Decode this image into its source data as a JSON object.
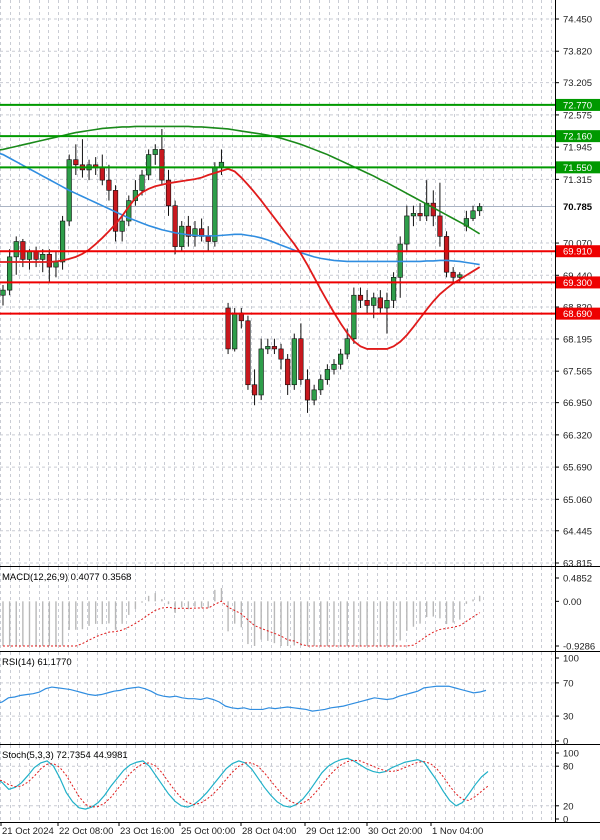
{
  "chart_data": {
    "type": "candlestick",
    "price_axis": {
      "ticks": [
        "74.450",
        "73.820",
        "73.205",
        "72.575",
        "71.945",
        "71.315",
        "70.070",
        "69.440",
        "68.820",
        "68.195",
        "67.565",
        "66.950",
        "66.320",
        "65.690",
        "65.060",
        "64.445",
        "63.815"
      ],
      "range": [
        63.815,
        74.45
      ]
    },
    "time_axis": {
      "labels": [
        "21 Oct 2024",
        "22 Oct 08:00",
        "23 Oct 16:00",
        "25 Oct 00:00",
        "28 Oct 04:00",
        "29 Oct 12:00",
        "30 Oct 20:00",
        "1 Nov 04:00"
      ]
    },
    "levels": [
      {
        "value": 72.77,
        "label": "72.770",
        "color": "#009900"
      },
      {
        "value": 72.16,
        "label": "72.160",
        "color": "#009900"
      },
      {
        "value": 71.55,
        "label": "71.550",
        "color": "#009900"
      },
      {
        "value": 69.91,
        "label": "69.910",
        "color": "#ee0000"
      },
      {
        "value": 69.3,
        "label": "69.300",
        "color": "#ee0000"
      },
      {
        "value": 68.69,
        "label": "68.690",
        "color": "#ee0000"
      }
    ],
    "current_price": {
      "value": 70.785,
      "label": "70.785"
    },
    "candles": [
      {
        "o": 69.05,
        "h": 69.25,
        "l": 68.85,
        "c": 69.15
      },
      {
        "o": 69.15,
        "h": 69.95,
        "l": 69.05,
        "c": 69.8
      },
      {
        "o": 69.8,
        "h": 70.2,
        "l": 69.45,
        "c": 70.1
      },
      {
        "o": 70.1,
        "h": 70.15,
        "l": 69.6,
        "c": 69.75
      },
      {
        "o": 69.75,
        "h": 69.95,
        "l": 69.55,
        "c": 69.9
      },
      {
        "o": 69.9,
        "h": 70.0,
        "l": 69.6,
        "c": 69.75
      },
      {
        "o": 69.75,
        "h": 69.95,
        "l": 69.5,
        "c": 69.85
      },
      {
        "o": 69.85,
        "h": 69.95,
        "l": 69.3,
        "c": 69.6
      },
      {
        "o": 69.6,
        "h": 69.9,
        "l": 69.4,
        "c": 69.7
      },
      {
        "o": 69.7,
        "h": 70.6,
        "l": 69.55,
        "c": 70.5
      },
      {
        "o": 70.5,
        "h": 71.8,
        "l": 70.4,
        "c": 71.7
      },
      {
        "o": 71.7,
        "h": 72.0,
        "l": 71.4,
        "c": 71.6
      },
      {
        "o": 71.6,
        "h": 72.1,
        "l": 71.35,
        "c": 71.5
      },
      {
        "o": 71.5,
        "h": 71.7,
        "l": 71.3,
        "c": 71.6
      },
      {
        "o": 71.6,
        "h": 71.75,
        "l": 71.4,
        "c": 71.55
      },
      {
        "o": 71.55,
        "h": 71.8,
        "l": 71.2,
        "c": 71.3
      },
      {
        "o": 71.3,
        "h": 71.6,
        "l": 70.9,
        "c": 71.1
      },
      {
        "o": 71.1,
        "h": 71.2,
        "l": 70.1,
        "c": 70.3
      },
      {
        "o": 70.3,
        "h": 70.6,
        "l": 70.1,
        "c": 70.5
      },
      {
        "o": 70.5,
        "h": 71.0,
        "l": 70.4,
        "c": 70.9
      },
      {
        "o": 70.9,
        "h": 71.3,
        "l": 70.8,
        "c": 71.1
      },
      {
        "o": 71.1,
        "h": 71.5,
        "l": 71.0,
        "c": 71.4
      },
      {
        "o": 71.4,
        "h": 71.9,
        "l": 71.3,
        "c": 71.8
      },
      {
        "o": 71.8,
        "h": 72.0,
        "l": 71.6,
        "c": 71.9
      },
      {
        "o": 71.9,
        "h": 72.3,
        "l": 71.2,
        "c": 71.3
      },
      {
        "o": 71.3,
        "h": 71.5,
        "l": 70.6,
        "c": 70.8
      },
      {
        "o": 70.8,
        "h": 70.9,
        "l": 69.85,
        "c": 70.0
      },
      {
        "o": 70.0,
        "h": 70.5,
        "l": 69.9,
        "c": 70.4
      },
      {
        "o": 70.4,
        "h": 70.6,
        "l": 70.0,
        "c": 70.2
      },
      {
        "o": 70.2,
        "h": 70.5,
        "l": 70.0,
        "c": 70.35
      },
      {
        "o": 70.35,
        "h": 70.55,
        "l": 70.1,
        "c": 70.2
      },
      {
        "o": 70.2,
        "h": 70.4,
        "l": 69.9,
        "c": 70.1
      },
      {
        "o": 70.1,
        "h": 71.65,
        "l": 70.0,
        "c": 71.55
      },
      {
        "o": 71.55,
        "h": 71.9,
        "l": 71.4,
        "c": 71.65
      },
      {
        "o": 68.8,
        "h": 68.9,
        "l": 67.9,
        "c": 68.0
      },
      {
        "o": 68.0,
        "h": 68.8,
        "l": 67.95,
        "c": 68.7
      },
      {
        "o": 68.7,
        "h": 68.8,
        "l": 68.4,
        "c": 68.55
      },
      {
        "o": 68.55,
        "h": 68.65,
        "l": 67.2,
        "c": 67.3
      },
      {
        "o": 67.3,
        "h": 67.6,
        "l": 66.9,
        "c": 67.1
      },
      {
        "o": 67.1,
        "h": 68.2,
        "l": 67.0,
        "c": 68.0
      },
      {
        "o": 68.0,
        "h": 68.2,
        "l": 67.9,
        "c": 68.05
      },
      {
        "o": 68.05,
        "h": 68.2,
        "l": 67.9,
        "c": 68.0
      },
      {
        "o": 68.0,
        "h": 68.1,
        "l": 67.6,
        "c": 67.8
      },
      {
        "o": 67.8,
        "h": 67.9,
        "l": 67.1,
        "c": 67.3
      },
      {
        "o": 67.3,
        "h": 68.3,
        "l": 67.2,
        "c": 68.2
      },
      {
        "o": 68.2,
        "h": 68.5,
        "l": 67.3,
        "c": 67.4
      },
      {
        "o": 67.4,
        "h": 67.6,
        "l": 66.75,
        "c": 67.0
      },
      {
        "o": 67.0,
        "h": 67.3,
        "l": 66.9,
        "c": 67.2
      },
      {
        "o": 67.2,
        "h": 67.5,
        "l": 67.1,
        "c": 67.4
      },
      {
        "o": 67.4,
        "h": 67.7,
        "l": 67.3,
        "c": 67.6
      },
      {
        "o": 67.6,
        "h": 67.8,
        "l": 67.5,
        "c": 67.7
      },
      {
        "o": 67.7,
        "h": 68.0,
        "l": 67.6,
        "c": 67.9
      },
      {
        "o": 67.9,
        "h": 68.4,
        "l": 67.8,
        "c": 68.2
      },
      {
        "o": 68.2,
        "h": 69.2,
        "l": 68.1,
        "c": 69.05
      },
      {
        "o": 69.05,
        "h": 69.2,
        "l": 68.8,
        "c": 68.95
      },
      {
        "o": 68.95,
        "h": 69.15,
        "l": 68.7,
        "c": 68.85
      },
      {
        "o": 68.85,
        "h": 69.1,
        "l": 68.6,
        "c": 69.0
      },
      {
        "o": 69.0,
        "h": 69.15,
        "l": 68.7,
        "c": 68.8
      },
      {
        "o": 68.8,
        "h": 69.1,
        "l": 68.3,
        "c": 68.95
      },
      {
        "o": 68.95,
        "h": 69.5,
        "l": 68.8,
        "c": 69.4
      },
      {
        "o": 69.4,
        "h": 70.2,
        "l": 69.0,
        "c": 70.05
      },
      {
        "o": 70.05,
        "h": 70.8,
        "l": 69.9,
        "c": 70.6
      },
      {
        "o": 70.6,
        "h": 70.8,
        "l": 70.4,
        "c": 70.65
      },
      {
        "o": 70.65,
        "h": 70.85,
        "l": 70.5,
        "c": 70.6
      },
      {
        "o": 70.6,
        "h": 71.3,
        "l": 70.5,
        "c": 70.85
      },
      {
        "o": 70.85,
        "h": 71.1,
        "l": 70.4,
        "c": 70.6
      },
      {
        "o": 70.6,
        "h": 71.25,
        "l": 70.0,
        "c": 70.2
      },
      {
        "o": 70.2,
        "h": 70.3,
        "l": 69.4,
        "c": 69.5
      },
      {
        "o": 69.5,
        "h": 69.6,
        "l": 69.3,
        "c": 69.4
      },
      {
        "o": 69.4,
        "h": 69.5,
        "l": 69.3,
        "c": 69.45
      },
      {
        "o": 70.4,
        "h": 70.7,
        "l": 70.3,
        "c": 70.55
      },
      {
        "o": 70.55,
        "h": 70.8,
        "l": 70.5,
        "c": 70.7
      },
      {
        "o": 70.7,
        "h": 70.85,
        "l": 70.6,
        "c": 70.785
      }
    ],
    "ma_green": [
      71.9,
      71.93,
      71.96,
      71.99,
      72.02,
      72.05,
      72.08,
      72.11,
      72.14,
      72.17,
      72.2,
      72.23,
      72.25,
      72.27,
      72.29,
      72.31,
      72.32,
      72.33,
      72.34,
      72.34,
      72.35,
      72.35,
      72.35,
      72.35,
      72.35,
      72.35,
      72.35,
      72.35,
      72.35,
      72.34,
      72.34,
      72.33,
      72.32,
      72.31,
      72.3,
      72.28,
      72.26,
      72.24,
      72.22,
      72.2,
      72.18,
      72.15,
      72.12,
      72.08,
      72.04,
      72.0,
      71.95,
      71.9,
      71.85,
      71.8,
      71.74,
      71.68,
      71.62,
      71.56,
      71.5,
      71.44,
      71.38,
      71.31,
      71.25,
      71.18,
      71.11,
      71.04,
      70.97,
      70.9,
      70.83,
      70.76,
      70.69,
      70.62,
      70.55,
      70.48,
      70.41,
      70.33,
      70.25
    ],
    "ma_blue": [
      71.8,
      71.73,
      71.66,
      71.59,
      71.52,
      71.45,
      71.38,
      71.31,
      71.24,
      71.17,
      71.1,
      71.04,
      70.98,
      70.92,
      70.86,
      70.8,
      70.74,
      70.68,
      70.62,
      70.56,
      70.51,
      70.46,
      70.41,
      70.37,
      70.33,
      70.3,
      70.27,
      70.25,
      70.23,
      70.22,
      70.21,
      70.21,
      70.21,
      70.22,
      70.23,
      70.24,
      70.24,
      70.22,
      70.2,
      70.17,
      70.13,
      70.08,
      70.03,
      69.98,
      69.93,
      69.88,
      69.84,
      69.8,
      69.77,
      69.75,
      69.73,
      69.72,
      69.71,
      69.71,
      69.71,
      69.71,
      69.71,
      69.71,
      69.71,
      69.71,
      69.71,
      69.71,
      69.71,
      69.71,
      69.72,
      69.72,
      69.73,
      69.73,
      69.72,
      69.71,
      69.69,
      69.67,
      69.65
    ],
    "ma_red": [
      69.7,
      69.7,
      69.7,
      69.7,
      69.7,
      69.7,
      69.7,
      69.7,
      69.71,
      69.73,
      69.76,
      69.8,
      69.86,
      69.94,
      70.05,
      70.17,
      70.3,
      70.44,
      70.6,
      70.78,
      70.95,
      71.06,
      71.13,
      71.18,
      71.21,
      71.24,
      71.26,
      71.28,
      71.3,
      71.32,
      71.35,
      71.4,
      71.44,
      71.48,
      71.52,
      71.47,
      71.35,
      71.21,
      71.06,
      70.9,
      70.73,
      70.56,
      70.39,
      70.22,
      70.05,
      69.86,
      69.64,
      69.4,
      69.16,
      68.93,
      68.71,
      68.5,
      68.31,
      68.15,
      68.05,
      68.0,
      68.0,
      68.0,
      68.0,
      68.05,
      68.14,
      68.27,
      68.43,
      68.6,
      68.77,
      68.93,
      69.07,
      69.18,
      69.28,
      69.36,
      69.44,
      69.52,
      69.6
    ],
    "macd": {
      "label": "MACD(12,26,9) 0.4077 0.3568",
      "ticks": [
        "0.4852",
        "0.00",
        "-0.9286"
      ],
      "range": [
        -0.9286,
        0.4852
      ]
    },
    "rsi": {
      "label": "RSI(14) 61.1770",
      "ticks": [
        "100",
        "70",
        "30",
        "0"
      ],
      "range": [
        0,
        100
      ],
      "values": [
        45,
        47,
        52,
        53,
        55,
        56,
        57,
        59,
        63,
        65,
        64,
        63,
        62,
        60,
        58,
        56,
        55,
        56,
        58,
        60,
        61,
        63,
        64,
        65,
        63,
        60,
        56,
        54,
        53,
        54,
        52,
        51,
        51,
        50,
        52,
        50,
        47,
        42,
        40,
        39,
        40,
        38,
        38,
        38,
        40,
        39,
        40,
        41,
        40,
        39,
        38,
        36,
        37,
        38,
        40,
        41,
        42,
        44,
        46,
        48,
        50,
        52,
        51,
        50,
        51,
        54,
        56,
        58,
        60,
        64,
        65,
        66,
        66,
        66,
        64,
        62,
        60,
        58,
        59,
        61
      ]
    },
    "stoch": {
      "label": "Stoch(5,3,3) 72.7354 44.9981",
      "ticks": [
        "100",
        "80",
        "20",
        "0"
      ],
      "range": [
        0,
        100
      ],
      "k": [
        62,
        55,
        45,
        48,
        55,
        66,
        78,
        85,
        88,
        80,
        62,
        40,
        26,
        17,
        15,
        18,
        25,
        36,
        50,
        62,
        74,
        82,
        86,
        88,
        80,
        66,
        52,
        38,
        27,
        20,
        18,
        22,
        30,
        40,
        52,
        64,
        76,
        84,
        88,
        85,
        76,
        62,
        48,
        36,
        26,
        20,
        18,
        22,
        30,
        42,
        56,
        70,
        80,
        86,
        90,
        92,
        88,
        82,
        76,
        72,
        70,
        72,
        78,
        82,
        86,
        88,
        90,
        86,
        72,
        58,
        42,
        28,
        20,
        25,
        38,
        52,
        64,
        72
      ],
      "d": [
        60,
        58,
        52,
        49,
        50,
        56,
        65,
        76,
        83,
        84,
        78,
        66,
        50,
        34,
        22,
        18,
        19,
        24,
        33,
        45,
        57,
        69,
        78,
        84,
        85,
        80,
        70,
        56,
        43,
        32,
        25,
        22,
        24,
        30,
        38,
        48,
        60,
        71,
        80,
        85,
        85,
        80,
        70,
        58,
        46,
        35,
        27,
        23,
        24,
        30,
        40,
        52,
        64,
        74,
        82,
        87,
        89,
        88,
        84,
        80,
        76,
        73,
        72,
        74,
        78,
        82,
        86,
        87,
        84,
        76,
        64,
        50,
        38,
        30,
        28,
        34,
        42,
        50
      ]
    }
  }
}
